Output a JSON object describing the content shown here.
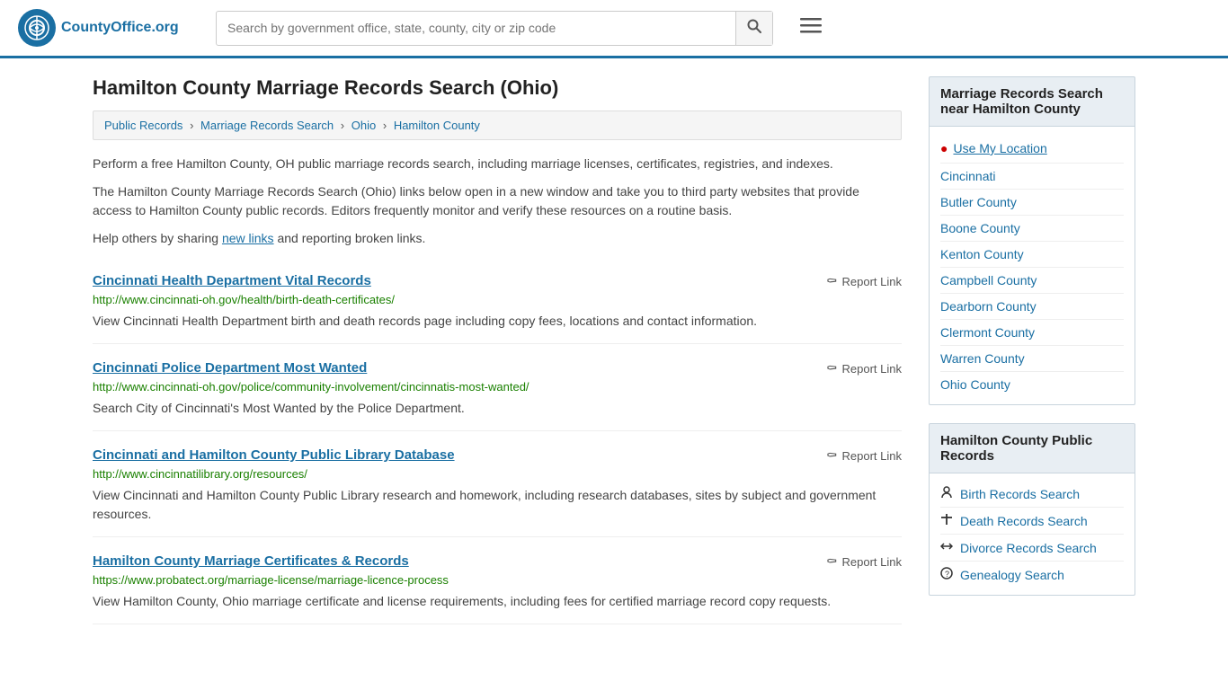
{
  "header": {
    "logo_text": "CountyOffice",
    "logo_suffix": ".org",
    "search_placeholder": "Search by government office, state, county, city or zip code"
  },
  "page": {
    "title": "Hamilton County Marriage Records Search (Ohio)",
    "breadcrumbs": [
      {
        "label": "Public Records",
        "href": "#"
      },
      {
        "label": "Marriage Records Search",
        "href": "#"
      },
      {
        "label": "Ohio",
        "href": "#"
      },
      {
        "label": "Hamilton County",
        "href": "#"
      }
    ],
    "description1": "Perform a free Hamilton County, OH public marriage records search, including marriage licenses, certificates, registries, and indexes.",
    "description2": "The Hamilton County Marriage Records Search (Ohio) links below open in a new window and take you to third party websites that provide access to Hamilton County public records. Editors frequently monitor and verify these resources on a routine basis.",
    "description3_before": "Help others by sharing ",
    "description3_link": "new links",
    "description3_after": " and reporting broken links."
  },
  "results": [
    {
      "title": "Cincinnati Health Department Vital Records",
      "url": "http://www.cincinnati-oh.gov/health/birth-death-certificates/",
      "description": "View Cincinnati Health Department birth and death records page including copy fees, locations and contact information.",
      "report_label": "Report Link"
    },
    {
      "title": "Cincinnati Police Department Most Wanted",
      "url": "http://www.cincinnati-oh.gov/police/community-involvement/cincinnatis-most-wanted/",
      "description": "Search City of Cincinnati's Most Wanted by the Police Department.",
      "report_label": "Report Link"
    },
    {
      "title": "Cincinnati and Hamilton County Public Library Database",
      "url": "http://www.cincinnatilibrary.org/resources/",
      "description": "View Cincinnati and Hamilton County Public Library research and homework, including research databases, sites by subject and government resources.",
      "report_label": "Report Link"
    },
    {
      "title": "Hamilton County Marriage Certificates & Records",
      "url": "https://www.probatect.org/marriage-license/marriage-licence-process",
      "description": "View Hamilton County, Ohio marriage certificate and license requirements, including fees for certified marriage record copy requests.",
      "report_label": "Report Link"
    }
  ],
  "sidebar": {
    "nearby_title": "Marriage Records Search near Hamilton County",
    "use_location_label": "Use My Location",
    "nearby_locations": [
      {
        "label": "Cincinnati"
      },
      {
        "label": "Butler County"
      },
      {
        "label": "Boone County"
      },
      {
        "label": "Kenton County"
      },
      {
        "label": "Campbell County"
      },
      {
        "label": "Dearborn County"
      },
      {
        "label": "Clermont County"
      },
      {
        "label": "Warren County"
      },
      {
        "label": "Ohio County"
      }
    ],
    "public_records_title": "Hamilton County Public Records",
    "public_records_items": [
      {
        "label": "Birth Records Search",
        "icon": "person"
      },
      {
        "label": "Death Records Search",
        "icon": "cross"
      },
      {
        "label": "Divorce Records Search",
        "icon": "arrows"
      },
      {
        "label": "Genealogy Search",
        "icon": "question"
      }
    ]
  }
}
